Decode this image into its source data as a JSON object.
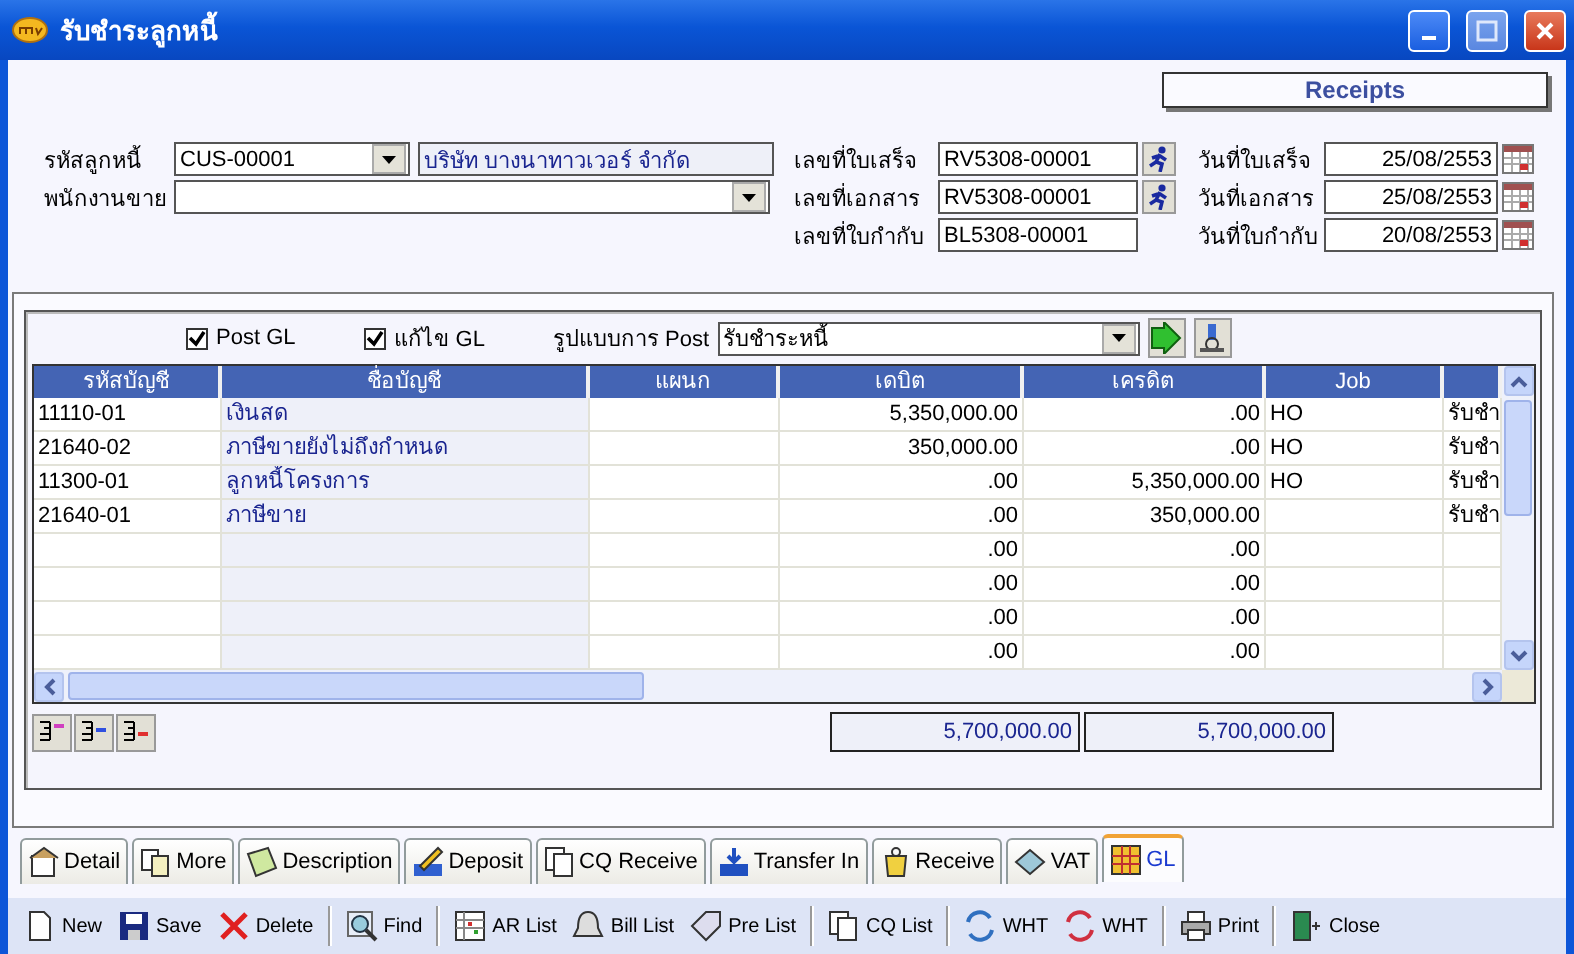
{
  "window": {
    "title": "รับชำระลูกหนี้"
  },
  "header_label": "Receipts",
  "form": {
    "left": [
      {
        "label": "รหัสลูกหนี้",
        "value": "CUS-00001",
        "name": "บริษัท บางนาทาวเวอร์ จำกัด"
      },
      {
        "label": "พนักงานขาย"
      }
    ],
    "middle": [
      {
        "label": "เลขที่ใบเสร็จ",
        "value": "RV5308-00001",
        "lookup": true
      },
      {
        "label": "เลขที่เอกสาร",
        "value": "RV5308-00001",
        "lookup": true
      },
      {
        "label": "เลขที่ใบกำกับ",
        "value": "BL5308-00001",
        "lookup": false
      }
    ],
    "right": [
      {
        "label": "วันที่ใบเสร็จ",
        "value": "25/08/2553"
      },
      {
        "label": "วันที่เอกสาร",
        "value": "25/08/2553"
      },
      {
        "label": "วันที่ใบกำกับ",
        "value": "20/08/2553"
      }
    ]
  },
  "post_options": {
    "checkboxes": [
      {
        "label": "Post GL",
        "checked": true
      },
      {
        "label": "แก้ไข GL",
        "checked": true
      }
    ],
    "format_label": "รูปแบบการ Post",
    "format_value": "รับชำระหนี้"
  },
  "table": {
    "columns": [
      "รหัสบัญชี",
      "ชื่อบัญชี",
      "แผนก",
      "เดบิต",
      "เครดิต",
      "Job"
    ],
    "rows": [
      {
        "account_code": "11110-01",
        "account_name": "เงินสด",
        "debit": "5,350,000.00",
        "credit": ".00",
        "job": "HO",
        "column_7": "รับชำ"
      },
      {
        "account_code": "21640-02",
        "account_name": "ภาษีขายยังไม่ถึงกำหนด",
        "debit": "350,000.00",
        "credit": ".00",
        "job": "HO",
        "column_7": "รับชำ"
      },
      {
        "account_code": "11300-01",
        "account_name": "ลูกหนี้โครงการ",
        "debit": ".00",
        "credit": "5,350,000.00",
        "job": "HO",
        "column_7": "รับชำ"
      },
      {
        "account_code": "21640-01",
        "account_name": "ภาษีขาย",
        "debit": ".00",
        "credit": "350,000.00",
        "column_7": "รับชำ"
      },
      {
        "debit": ".00",
        "credit": ".00"
      },
      {
        "debit": ".00",
        "credit": ".00"
      },
      {
        "debit": ".00",
        "credit": ".00"
      },
      {
        "debit": ".00",
        "credit": ".00"
      }
    ],
    "totals": [
      "5,700,000.00",
      "5,700,000.00"
    ]
  },
  "tabs": [
    {
      "label": "Detail",
      "selected": false
    },
    {
      "label": "More",
      "selected": false
    },
    {
      "label": "Description",
      "selected": false
    },
    {
      "label": "Deposit",
      "selected": false
    },
    {
      "label": "CQ Receive",
      "selected": false
    },
    {
      "label": "Transfer In",
      "selected": false
    },
    {
      "label": "Receive",
      "selected": false
    },
    {
      "label": "VAT",
      "selected": false
    },
    {
      "label": "GL",
      "selected": true
    }
  ],
  "toolbar": [
    {
      "label": "New",
      "separator_after": false
    },
    {
      "label": "Save",
      "separator_after": false
    },
    {
      "label": "Delete",
      "separator_after": true
    },
    {
      "label": "Find",
      "separator_after": true
    },
    {
      "label": "AR List",
      "separator_after": false
    },
    {
      "label": "Bill List",
      "separator_after": false
    },
    {
      "label": "Pre List",
      "separator_after": true
    },
    {
      "label": "CQ List",
      "separator_after": true
    },
    {
      "label": "WHT",
      "separator_after": false
    },
    {
      "label": "WHT",
      "separator_after": true
    },
    {
      "label": "Print",
      "separator_after": true
    },
    {
      "label": "Close",
      "separator_after": false
    }
  ]
}
